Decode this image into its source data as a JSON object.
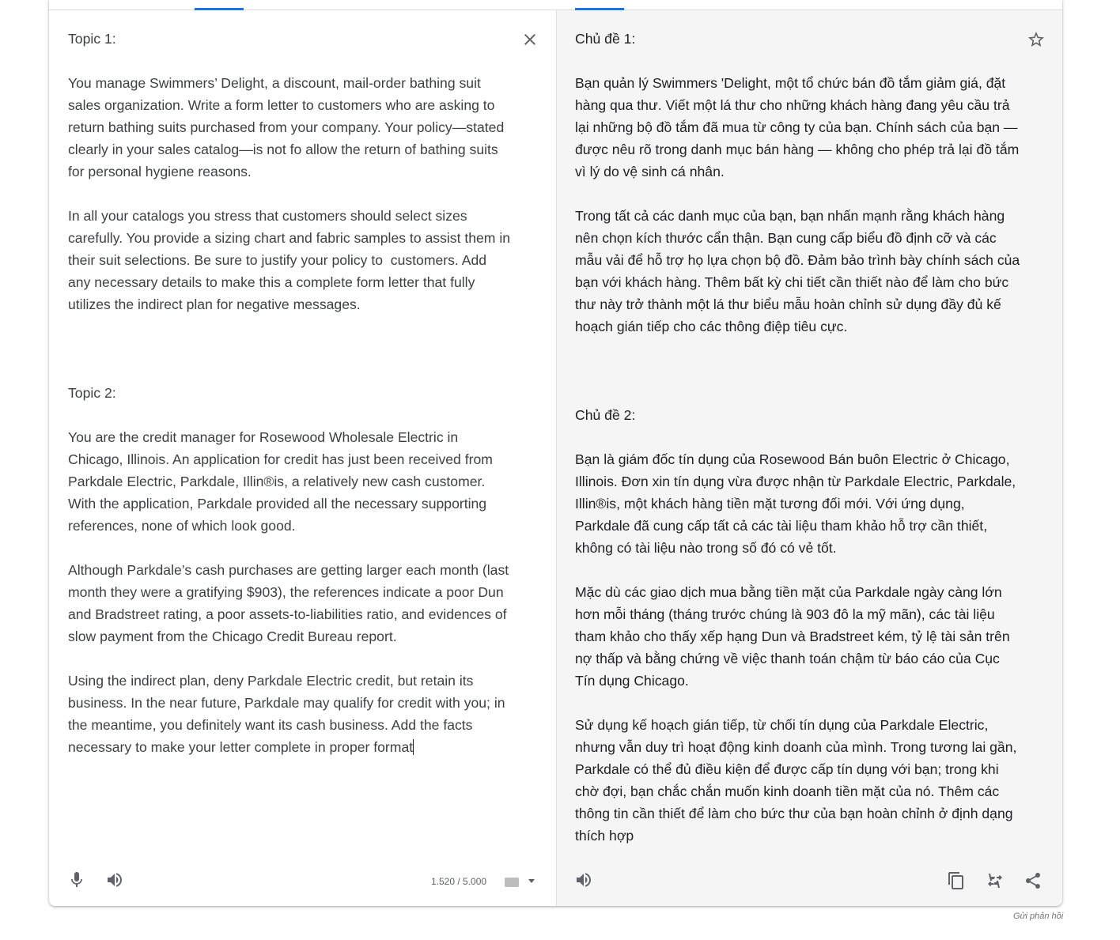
{
  "source": {
    "text": "Topic 1:\n\nYou manage Swimmers’ Delight, a discount, mail-order bathing suit sales organization. Write a form letter to customers who are asking to return bathing suits purchased from your company. Your policy—stated clearly in your sales catalog—is not fo allow the return of bathing suits for personal hygiene reasons.\n\nIn all your catalogs you stress that customers should select sizes carefully. You provide a sizing chart and fabric samples to assist them in their suit selections. Be sure to justify your policy to  customers. Add any necessary details to make this a complete form letter that fully utilizes the indirect plan for negative messages.\n\n\n\nTopic 2:\n\nYou are the credit manager for Rosewood Wholesale Electric in Chicago, Illinois. An application for credit has just been received from Parkdale Electric, Parkdale, Illin®is, a relatively new cash customer. With the application, Parkdale provided all the necessary supporting references, none of which look good.\n\nAlthough Parkdale’s cash purchases are getting larger each month (last month they were a gratifying $903), the references indicate a poor Dun and Bradstreet rating, a poor assets-to-liabilities ratio, and evidences of slow payment from the Chicago Credit Bureau report.\n\nUsing the indirect plan, deny Parkdale Electric credit, but retain its business. In the near future, Parkdale may qualify for credit with you; in the meantime, you definitely want its cash business. Add the facts necessary to make your letter complete in proper format",
    "char_count": "1.520 / 5.000"
  },
  "target": {
    "text": "Chủ đề 1:\n\nBạn quản lý Swimmers 'Delight, một tổ chức bán đồ tắm giảm giá, đặt hàng qua thư. Viết một lá thư cho những khách hàng đang yêu cầu trả lại những bộ đồ tắm đã mua từ công ty của bạn. Chính sách của bạn — được nêu rõ trong danh mục bán hàng — không cho phép trả lại đồ tắm vì lý do vệ sinh cá nhân.\n\nTrong tất cả các danh mục của bạn, bạn nhấn mạnh rằng khách hàng nên chọn kích thước cẩn thận. Bạn cung cấp biểu đồ định cỡ và các mẫu vải để hỗ trợ họ lựa chọn bộ đồ. Đảm bảo trình bày chính sách của bạn với khách hàng. Thêm bất kỳ chi tiết cần thiết nào để làm cho bức thư này trở thành một lá thư biểu mẫu hoàn chỉnh sử dụng đầy đủ kế hoạch gián tiếp cho các thông điệp tiêu cực.\n\n\n\nChủ đề 2:\n\nBạn là giám đốc tín dụng của Rosewood Bán buôn Electric ở Chicago, Illinois. Đơn xin tín dụng vừa được nhận từ Parkdale Electric, Parkdale, Illin®is, một khách hàng tiền mặt tương đối mới. Với ứng dụng, Parkdale đã cung cấp tất cả các tài liệu tham khảo hỗ trợ cần thiết, không có tài liệu nào trong số đó có vẻ tốt.\n\nMặc dù các giao dịch mua bằng tiền mặt của Parkdale ngày càng lớn hơn mỗi tháng (tháng trước chúng là 903 đô la mỹ mãn), các tài liệu tham khảo cho thấy xếp hạng Dun và Bradstreet kém, tỷ lệ tài sản trên nợ thấp và bằng chứng về việc thanh toán chậm từ báo cáo của Cục Tín dụng Chicago.\n\nSử dụng kế hoạch gián tiếp, từ chối tín dụng của Parkdale Electric, nhưng vẫn duy trì hoạt động kinh doanh của mình. Trong tương lai gần, Parkdale có thể đủ điều kiện để được cấp tín dụng với bạn; trong khi chờ đợi, bạn chắc chắn muốn kinh doanh tiền mặt của nó. Thêm các thông tin cần thiết để làm cho bức thư của bạn hoàn chỉnh ở định dạng thích hợp"
  },
  "footer": {
    "feedback": "Gửi phản hồi"
  },
  "icons": {
    "close": "close-icon",
    "star": "star-icon",
    "mic": "mic-icon",
    "speaker": "volume-icon",
    "keyboard": "keyboard-icon",
    "copy": "copy-icon",
    "rate": "rate-translation-icon",
    "share": "share-icon"
  },
  "colors": {
    "accent": "#1a73e8",
    "target_background": "#f5f5f5"
  }
}
